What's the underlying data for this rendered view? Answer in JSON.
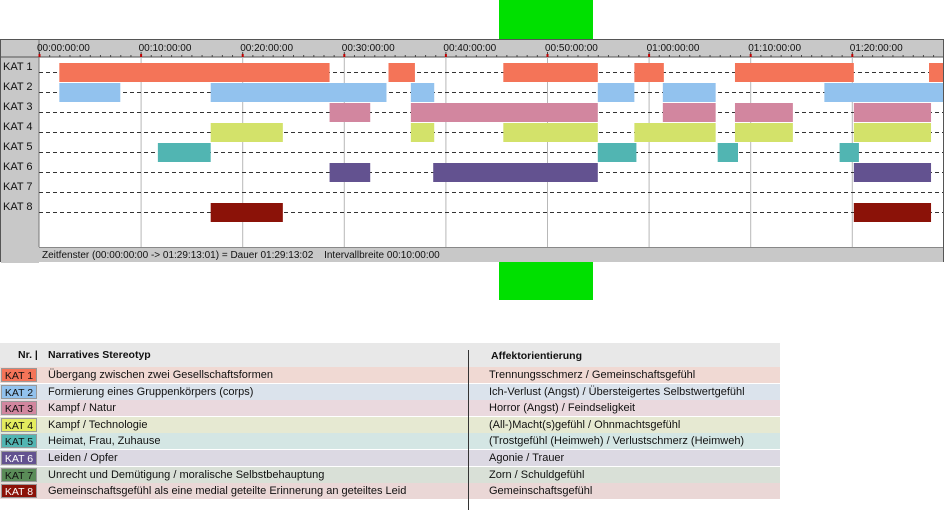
{
  "chart_data": {
    "type": "timeline",
    "time_unit": "minutes",
    "x_range": [
      0,
      89.2172
    ],
    "x_ticks": [
      "00:00:00:00",
      "00:10:00:00",
      "00:20:00:00",
      "00:30:00:00",
      "00:40:00:00",
      "00:50:00:00",
      "01:00:00:00",
      "01:10:00:00",
      "01:20:00:00"
    ],
    "categories": [
      {
        "label": "KAT 1",
        "color": "#f47458",
        "segments": [
          [
            2,
            28.6
          ],
          [
            34.4,
            37
          ],
          [
            45.7,
            55
          ],
          [
            58.6,
            61.5
          ],
          [
            68.5,
            80.2
          ],
          [
            87.6,
            89.2
          ]
        ]
      },
      {
        "label": "KAT 2",
        "color": "#92c2ee",
        "segments": [
          [
            2,
            8
          ],
          [
            16.9,
            34.2
          ],
          [
            36.6,
            38.9
          ],
          [
            55,
            58.6
          ],
          [
            61.4,
            66.6
          ],
          [
            77.3,
            89.2
          ]
        ]
      },
      {
        "label": "KAT 3",
        "color": "#d2869f",
        "segments": [
          [
            28.6,
            32.6
          ],
          [
            36.6,
            55
          ],
          [
            61.4,
            66.6
          ],
          [
            68.5,
            74.2
          ],
          [
            80.2,
            87.8
          ]
        ]
      },
      {
        "label": "KAT 4",
        "color": "#d3e26a",
        "segments": [
          [
            16.9,
            24
          ],
          [
            36.6,
            38.9
          ],
          [
            45.7,
            55
          ],
          [
            58.6,
            66.6
          ],
          [
            68.5,
            74.2
          ],
          [
            80.2,
            87.8
          ]
        ]
      },
      {
        "label": "KAT 5",
        "color": "#51b5b2",
        "segments": [
          [
            11.7,
            16.9
          ],
          [
            55,
            58.8
          ],
          [
            66.8,
            68.8
          ],
          [
            78.8,
            80.7
          ]
        ]
      },
      {
        "label": "KAT 6",
        "color": "#635290",
        "segments": [
          [
            28.6,
            32.6
          ],
          [
            38.8,
            55
          ],
          [
            80.2,
            87.8
          ]
        ]
      },
      {
        "label": "KAT 7",
        "color": "#5a8c58",
        "segments": []
      },
      {
        "label": "KAT 8",
        "color": "#8b1208",
        "segments": [
          [
            16.9,
            24
          ],
          [
            80.2,
            87.8
          ]
        ]
      }
    ],
    "status": {
      "window": "Zeitfenster (00:00:00:00 -> 01:29:13:01) = Dauer 01:29:13:02",
      "interval": "Intervallbreite 00:10:00:00"
    }
  },
  "legend": {
    "header_nr": "Nr. |",
    "header_stereotype": "Narratives Stereotyp",
    "header_affect": "Affektorientierung",
    "rows": [
      {
        "cat": "KAT 1",
        "color": "#f47458",
        "row_bg": "#f0d9d3",
        "stereotype": "Übergang zwischen zwei Gesellschaftsformen",
        "affect": "Trennungsschmerz / Gemeinschaftsgefühl"
      },
      {
        "cat": "KAT 2",
        "color": "#92c2ee",
        "row_bg": "#dbe3ec",
        "stereotype": "Formierung eines Gruppenkörpers (corps)",
        "affect": "Ich-Verlust (Angst) / Übersteigertes Selbstwertgefühl"
      },
      {
        "cat": "KAT 3",
        "color": "#d2869f",
        "row_bg": "#ead9de",
        "stereotype": "Kampf / Natur",
        "affect": "Horror (Angst) / Feindseligkeit"
      },
      {
        "cat": "KAT 4",
        "color": "#e4ec5e",
        "row_bg": "#e6e9d2",
        "stereotype": "Kampf / Technologie",
        "affect": "(All-)Macht(s)gefühl / Ohnmachtsgefühl"
      },
      {
        "cat": "KAT 5",
        "color": "#51b5b2",
        "row_bg": "#d4e6e4",
        "stereotype": "Heimat, Frau, Zuhause",
        "affect": "(Trostgefühl (Heimweh) / Verlustschmerz (Heimweh)"
      },
      {
        "cat": "KAT 6",
        "color": "#635290",
        "row_bg": "#dcd9e3",
        "stereotype": "Leiden / Opfer",
        "affect": "Agonie / Trauer"
      },
      {
        "cat": "KAT 7",
        "color": "#5a8c58",
        "row_bg": "#d9e0d7",
        "stereotype": "Unrecht und Demütigung / moralische Selbstbehauptung",
        "affect": "Zorn / Schuldgefühl"
      },
      {
        "cat": "KAT 8",
        "color": "#8b1208",
        "row_bg": "#ead7d6",
        "stereotype": "Gemeinschaftsgefühl als eine medial geteilte Erinnerung an geteiltes Leid",
        "affect": "Gemeinschaftsgefühl"
      }
    ]
  }
}
